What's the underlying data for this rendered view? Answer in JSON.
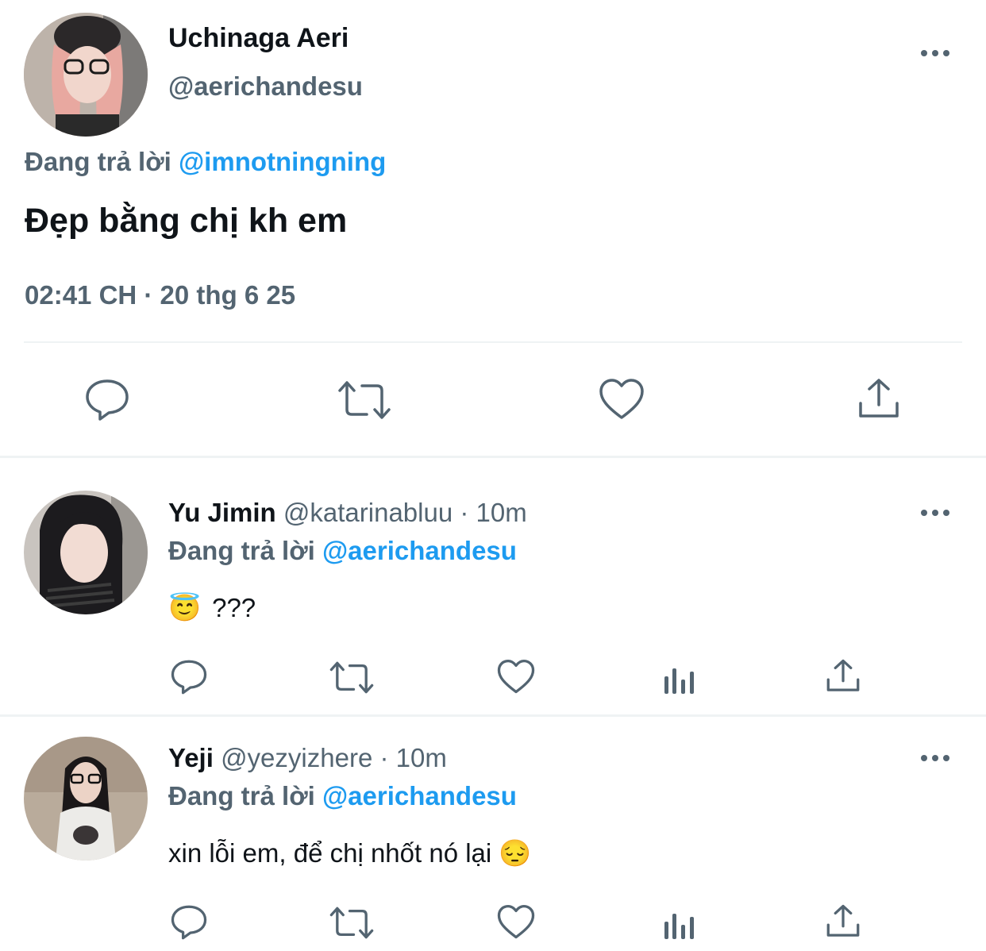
{
  "main_tweet": {
    "display_name": "Uchinaga Aeri",
    "handle": "@aerichandesu",
    "reply_prefix": "Đang trả lời",
    "reply_to": "@imnotningning",
    "text": "Đẹp bằng chị kh em",
    "timestamp": "02:41 CH · 20 thg 6 25"
  },
  "replies": [
    {
      "display_name": "Yu Jimin",
      "handle": "@katarinabluu",
      "time": "· 10m",
      "reply_prefix": "Đang trả lời",
      "reply_to": "@aerichandesu",
      "emoji": "😇",
      "text": "???"
    },
    {
      "display_name": "Yeji",
      "handle": "@yezyizhere",
      "time": "· 10m",
      "reply_prefix": "Đang trả lời",
      "reply_to": "@aerichandesu",
      "text": "xin lỗi em, để chị nhốt nó lại",
      "emoji": "😔"
    }
  ],
  "colors": {
    "accent": "#1d9bf0",
    "muted": "#536471",
    "text": "#0f1419",
    "divider": "#eff3f4"
  },
  "icons": [
    "reply-icon",
    "retweet-icon",
    "like-icon",
    "share-icon",
    "views-icon",
    "more-icon"
  ]
}
